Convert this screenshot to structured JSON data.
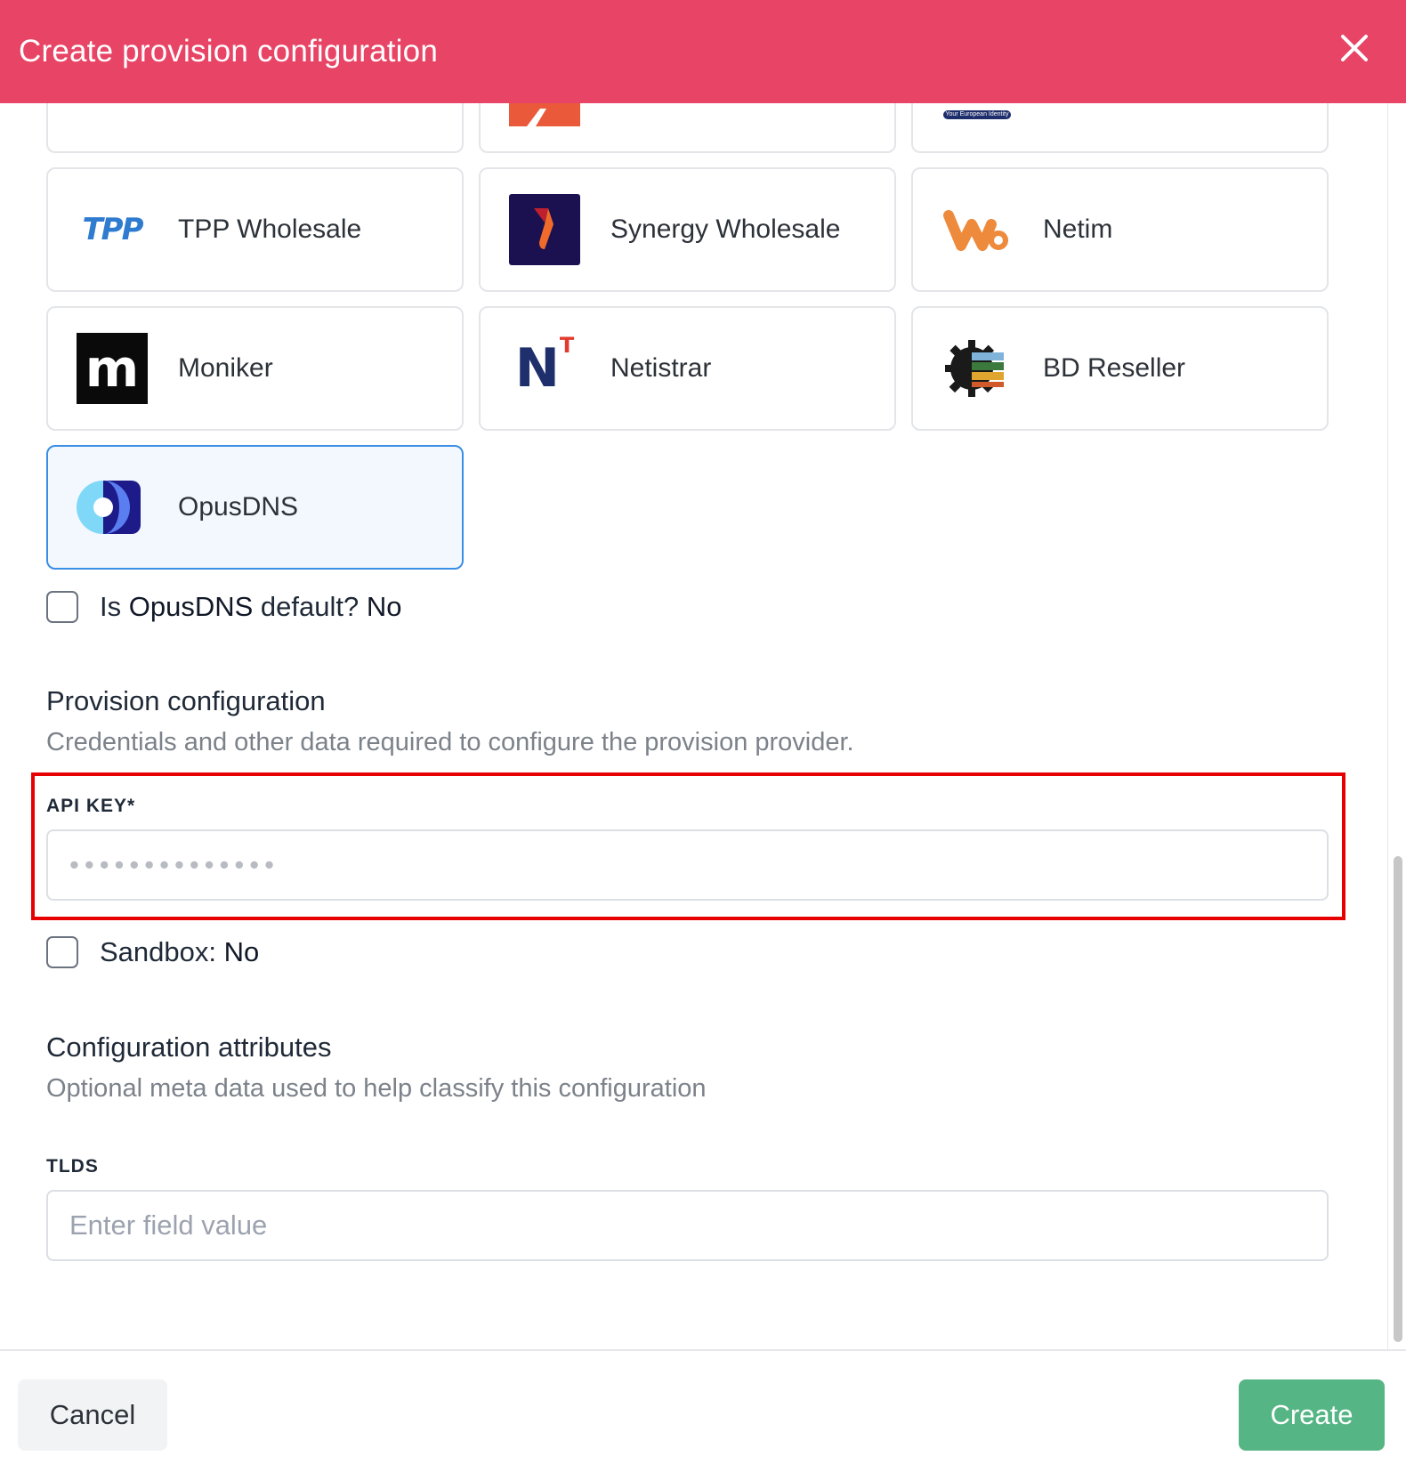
{
  "header": {
    "title": "Create provision configuration",
    "close_icon": "close-icon"
  },
  "providers": [
    {
      "name": "",
      "icon": "partial-provider-logo"
    },
    {
      "name": "",
      "icon": "partial-provider-logo-red"
    },
    {
      "name": "",
      "icon": "your-european-identity-logo",
      "logo_text": "Your European Identity"
    },
    {
      "name": "TPP Wholesale",
      "icon": "tpp-wholesale-logo",
      "logo_text": "TPP"
    },
    {
      "name": "Synergy Wholesale",
      "icon": "synergy-wholesale-logo"
    },
    {
      "name": "Netim",
      "icon": "netim-logo"
    },
    {
      "name": "Moniker",
      "icon": "moniker-logo",
      "logo_text": "m"
    },
    {
      "name": "Netistrar",
      "icon": "netistrar-logo",
      "logo_text": "N",
      "logo_sup": "T"
    },
    {
      "name": "BD Reseller",
      "icon": "bd-reseller-logo"
    },
    {
      "name": "OpusDNS",
      "icon": "opusdns-logo",
      "selected": true
    }
  ],
  "default_toggle": {
    "prefix": "Is",
    "provider": "OpusDNS",
    "suffix": "default?",
    "value": "No"
  },
  "provision_section": {
    "title": "Provision configuration",
    "subtitle": "Credentials and other data required to configure the provision provider."
  },
  "api_key": {
    "label": "API KEY*",
    "placeholder": "••••••••••••••"
  },
  "sandbox": {
    "label": "Sandbox:",
    "value": "No"
  },
  "attributes_section": {
    "title": "Configuration attributes",
    "subtitle": "Optional meta data used to help classify this configuration"
  },
  "tlds": {
    "label": "TLDS",
    "placeholder": "Enter field value"
  },
  "footer": {
    "cancel_label": "Cancel",
    "create_label": "Create"
  },
  "colors": {
    "header": "#e84466",
    "create": "#56b585",
    "selected_border": "#3b8ee6",
    "highlight": "#e60000"
  }
}
